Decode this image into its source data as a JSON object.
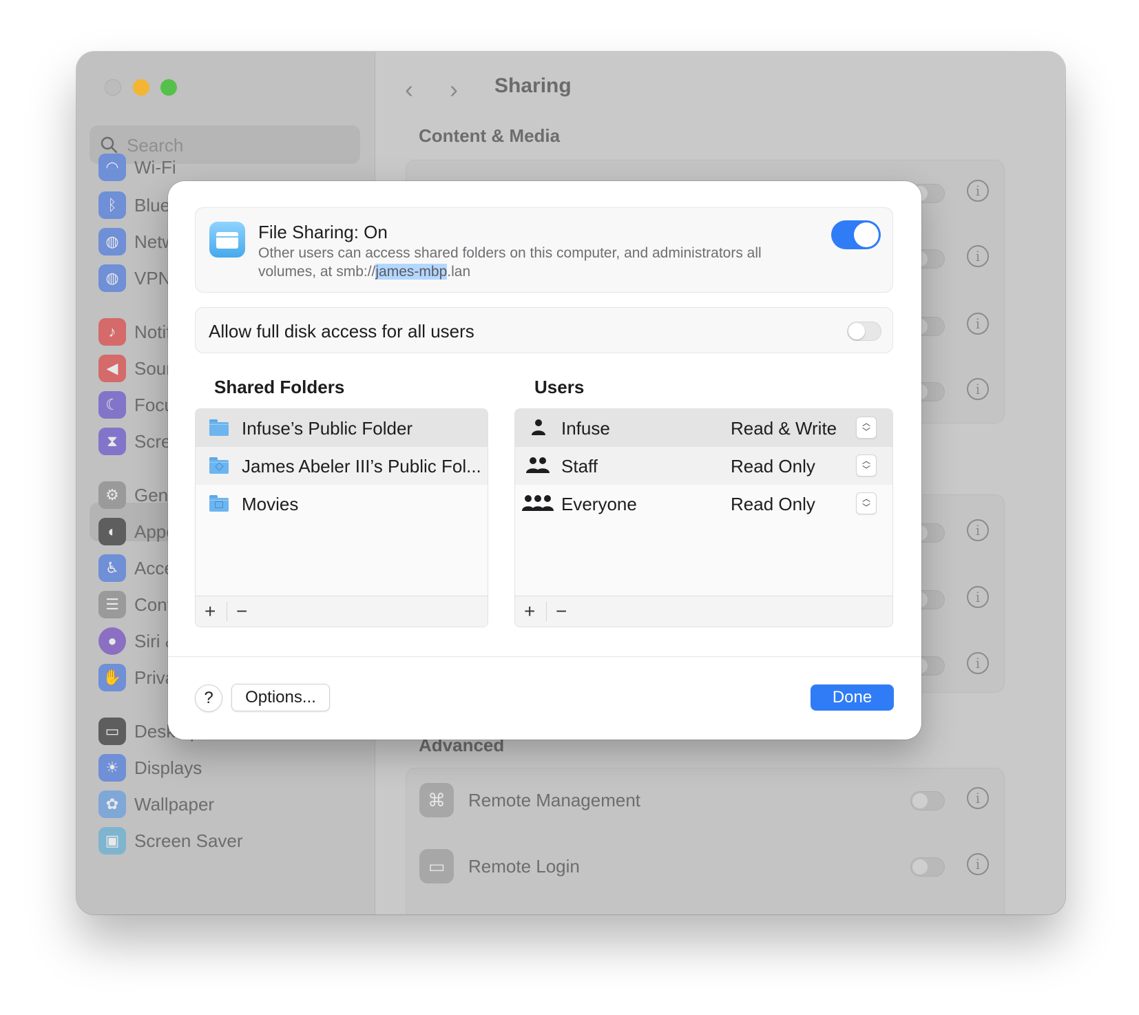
{
  "background_window": {
    "search_placeholder": "Search",
    "sidebar_items": [
      {
        "label": "Wi-Fi",
        "icon": "wifi-icon",
        "color": "#6f8fd6"
      },
      {
        "label": "Bluet",
        "icon": "bluetooth-icon",
        "color": "#6f8fd6"
      },
      {
        "label": "Netw",
        "icon": "globe-icon",
        "color": "#6f8fd6"
      },
      {
        "label": "VPN",
        "icon": "vpn-globe-icon",
        "color": "#6f8fd6"
      },
      {
        "label": "Notif",
        "icon": "bell-icon",
        "color": "#d46a6a"
      },
      {
        "label": "Soun",
        "icon": "speaker-icon",
        "color": "#d46a6a"
      },
      {
        "label": "Focu",
        "icon": "moon-icon",
        "color": "#8275c9"
      },
      {
        "label": "Scre",
        "icon": "hourglass-icon",
        "color": "#8275c9"
      },
      {
        "label": "Gene",
        "icon": "gear-icon",
        "color": "#9a9a9a"
      },
      {
        "label": "Appe",
        "icon": "appearance-icon",
        "color": "#5e5e5e"
      },
      {
        "label": "Acce",
        "icon": "accessibility-icon",
        "color": "#6f8fd6"
      },
      {
        "label": "Cont",
        "icon": "control-center-icon",
        "color": "#9a9a9a"
      },
      {
        "label": "Siri &",
        "icon": "siri-icon",
        "color": "#8a6fc2"
      },
      {
        "label": "Priva",
        "icon": "hand-icon",
        "color": "#6f8fd6"
      },
      {
        "label": "Desktop & Dock",
        "icon": "dock-icon",
        "color": "#5e5e5e"
      },
      {
        "label": "Displays",
        "icon": "sun-icon",
        "color": "#6f8fd6"
      },
      {
        "label": "Wallpaper",
        "icon": "flower-icon",
        "color": "#7fa7d8"
      },
      {
        "label": "Screen Saver",
        "icon": "screensaver-icon",
        "color": "#7fb4cf"
      }
    ],
    "title": "Sharing",
    "back_glyph": "‹",
    "forward_glyph": "›",
    "section_content_media": "Content & Media",
    "section_advanced": "Advanced",
    "rows_advanced": [
      "Remote Management",
      "Remote Login"
    ]
  },
  "dialog": {
    "file_sharing": {
      "title": "File Sharing: On",
      "desc_before": "Other users can access shared folders on this computer, and administrators all volumes, at smb://",
      "desc_highlight": "james-mbp",
      "desc_after": ".lan",
      "enabled": true
    },
    "full_disk": {
      "label": "Allow full disk access for all users",
      "enabled": false
    },
    "shared_folders": {
      "heading": "Shared Folders",
      "items": [
        {
          "name": "Infuse’s Public Folder",
          "icon": "folder-icon"
        },
        {
          "name": "James Abeler III’s Public Fol...",
          "icon": "public-folder-icon"
        },
        {
          "name": "Movies",
          "icon": "movies-folder-icon"
        }
      ]
    },
    "users": {
      "heading": "Users",
      "items": [
        {
          "name": "Infuse",
          "permission": "Read & Write",
          "icon": "person-icon"
        },
        {
          "name": "Staff",
          "permission": "Read Only",
          "icon": "two-people-icon"
        },
        {
          "name": "Everyone",
          "permission": "Read Only",
          "icon": "three-people-icon"
        }
      ]
    },
    "add_label": "+",
    "remove_label": "−",
    "help_label": "?",
    "options_label": "Options...",
    "done_label": "Done",
    "accent_color": "#2f7cf6"
  }
}
